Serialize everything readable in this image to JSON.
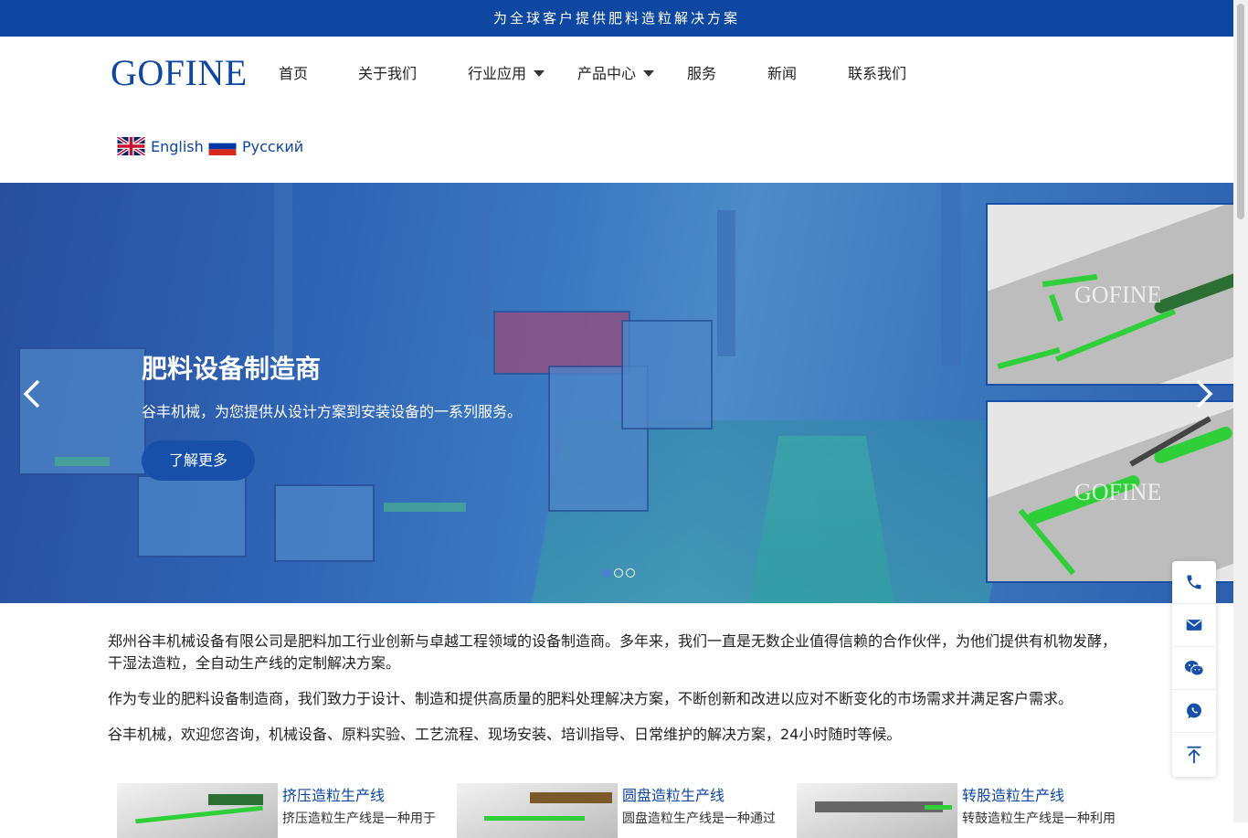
{
  "topbar": {
    "text": "为全球客户提供肥料造粒解决方案"
  },
  "header": {
    "logo": "GOFINE",
    "nav": [
      {
        "label": "首页",
        "has_dropdown": false
      },
      {
        "label": "关于我们",
        "has_dropdown": false
      },
      {
        "label": "行业应用",
        "has_dropdown": true
      },
      {
        "label": "产品中心",
        "has_dropdown": true
      },
      {
        "label": "服务",
        "has_dropdown": false
      },
      {
        "label": "新闻",
        "has_dropdown": false
      },
      {
        "label": "联系我们",
        "has_dropdown": false
      }
    ],
    "languages": [
      {
        "label": "English",
        "icon": "uk-flag-icon"
      },
      {
        "label": "Русский",
        "icon": "russia-flag-icon"
      }
    ]
  },
  "hero": {
    "title": "肥料设备制造商",
    "subtitle": "谷丰机械，为您提供从设计方案到安装设备的一系列服务。",
    "button_label": "了解更多",
    "prev_icon": "chevron-left-icon",
    "next_icon": "chevron-right-icon",
    "slide_count": 3,
    "active_slide": 1,
    "watermark": "GOFINE"
  },
  "intro": {
    "paragraphs": [
      "郑州谷丰机械设备有限公司是肥料加工行业创新与卓越工程领域的设备制造商。多年来，我们一直是无数企业值得信赖的合作伙伴，为他们提供有机物发酵，干湿法造粒，全自动生产线的定制解决方案。",
      "作为专业的肥料设备制造商，我们致力于设计、制造和提供高质量的肥料处理解决方案，不断创新和改进以应对不断变化的市场需求并满足客户需求。",
      "谷丰机械，欢迎您咨询，机械设备、原料实验、工艺流程、现场安装、培训指导、日常维护的解决方案，24小时随时等候。"
    ]
  },
  "products": [
    {
      "title": "挤压造粒生产线",
      "desc": "挤压造粒生产线是一种用于"
    },
    {
      "title": "圆盘造粒生产线",
      "desc": "圆盘造粒生产线是一种通过"
    },
    {
      "title": "转股造粒生产线",
      "desc": "转鼓造粒生产线是一种利用"
    }
  ],
  "floatbar": {
    "items": [
      "phone-icon",
      "mail-icon",
      "wechat-icon",
      "whatsapp-icon",
      "back-to-top-icon"
    ]
  },
  "colors": {
    "brand_blue": "#0d47a1",
    "button_blue": "#1650a8",
    "equipment_green": "#2fcf3a"
  }
}
